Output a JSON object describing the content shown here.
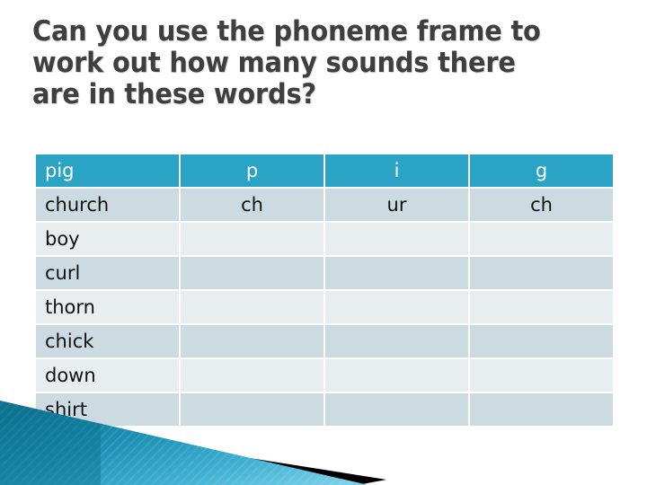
{
  "slide": {
    "title_lines": [
      "Can you use the phoneme frame to",
      "work out how many sounds there",
      "are in these words?"
    ],
    "title_color": "#3f3f3f",
    "background_color": "#ffffff"
  },
  "table": {
    "header": {
      "word": "pig",
      "sound1": "p",
      "sound2": "i",
      "sound3": "g"
    },
    "header_bg": "#2ba3c4",
    "header_text_color": "#ffffff",
    "row_dark_bg": "#cbdbe1",
    "row_light_bg": "#e8eef0",
    "rows": [
      {
        "word": "church",
        "sound1": "ch",
        "sound2": "ur",
        "sound3": "ch"
      },
      {
        "word": "boy",
        "sound1": "",
        "sound2": "",
        "sound3": ""
      },
      {
        "word": "curl",
        "sound1": "",
        "sound2": "",
        "sound3": ""
      },
      {
        "word": "thorn",
        "sound1": "",
        "sound2": "",
        "sound3": ""
      },
      {
        "word": "chick",
        "sound1": "",
        "sound2": "",
        "sound3": ""
      },
      {
        "word": "down",
        "sound1": "",
        "sound2": "",
        "sound3": ""
      },
      {
        "word": "shirt",
        "sound1": "",
        "sound2": "",
        "sound3": ""
      }
    ]
  },
  "decoration": {
    "teal_dark": "#0f7c99",
    "teal_mid": "#2196ba",
    "teal_light": "#6cc6e2",
    "black_band": "#000000",
    "pale_blue": "#dce9ef"
  }
}
